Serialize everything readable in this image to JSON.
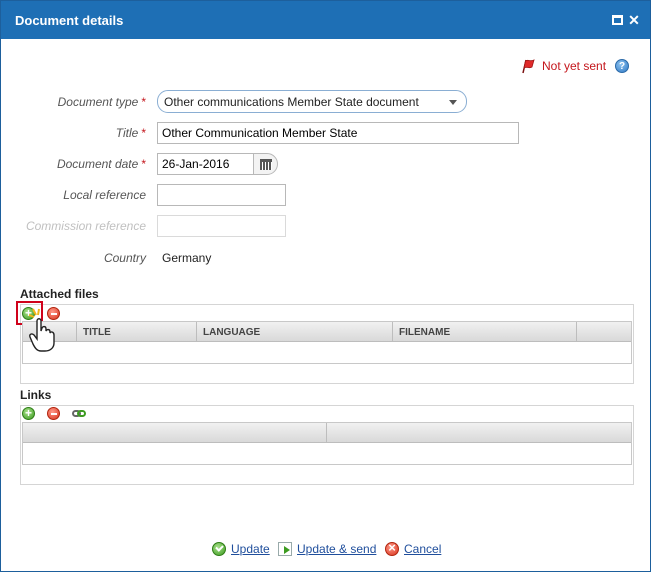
{
  "window": {
    "title": "Document details",
    "maximize_icon": "maximize-icon",
    "close_glyph": "✕"
  },
  "status": {
    "text": "Not yet sent",
    "icon": "red-flag-icon",
    "help_icon": "help-icon",
    "help_glyph": "?"
  },
  "form": {
    "document_type": {
      "label": "Document type",
      "required": "*",
      "value": "Other communications Member State document"
    },
    "title": {
      "label": "Title",
      "required": "*",
      "value": "Other Communication Member  State"
    },
    "document_date": {
      "label": "Document date",
      "required": "*",
      "value": "26-Jan-2016"
    },
    "local_reference": {
      "label": "Local reference",
      "value": ""
    },
    "commission_reference": {
      "label": "Commission reference",
      "value": ""
    },
    "country": {
      "label": "Country",
      "value": "Germany"
    }
  },
  "attached_files": {
    "title": "Attached files",
    "columns": [
      "",
      "TITLE",
      "LANGUAGE",
      "FILENAME",
      ""
    ],
    "rows": []
  },
  "links": {
    "title": "Links",
    "columns": [
      "",
      ""
    ],
    "rows": []
  },
  "footer": {
    "update": "Update",
    "update_send": "Update & send",
    "cancel": "Cancel"
  },
  "colors": {
    "titlebar": "#1e6fb5",
    "required": "#c4161c",
    "link": "#1f4e9c",
    "highlight": "#d0021b"
  }
}
